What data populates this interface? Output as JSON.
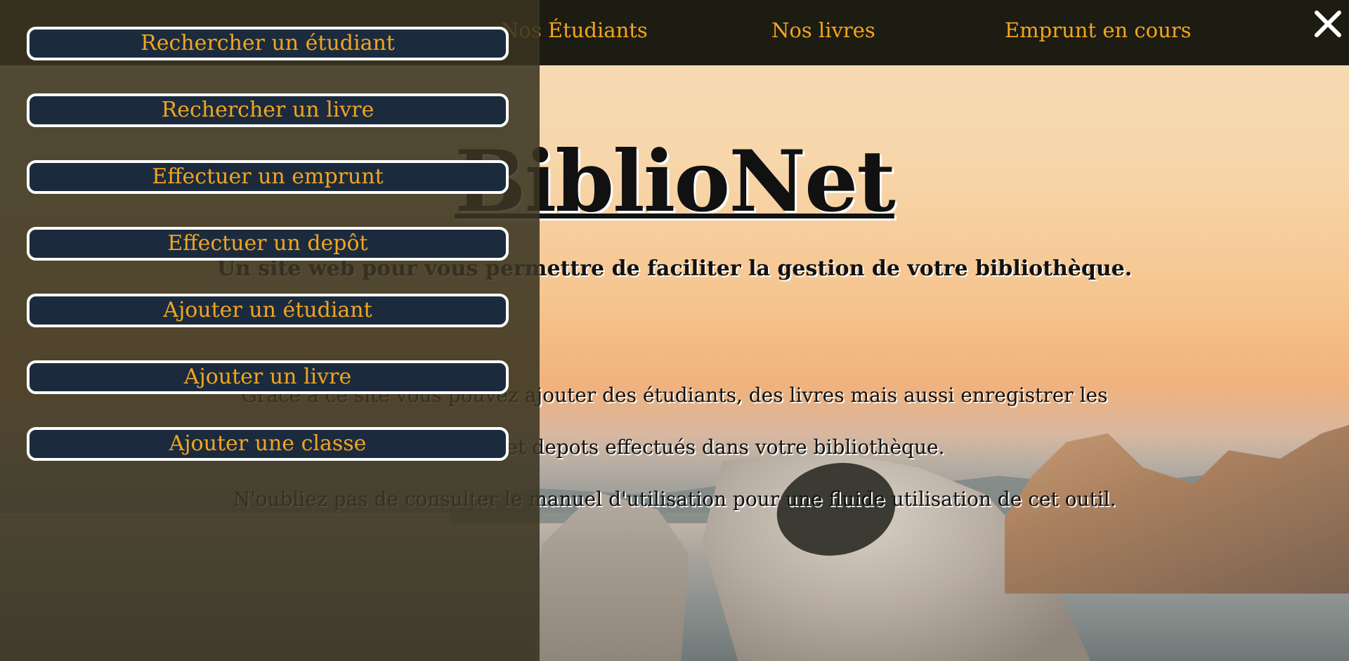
{
  "navbar": {
    "links": [
      {
        "label": "Nos Étudiants"
      },
      {
        "label": "Nos livres"
      },
      {
        "label": "Emprunt en cours"
      }
    ]
  },
  "main": {
    "title": "BiblioNet",
    "tagline": "Un site web pour vous permettre de faciliter la gestion de votre bibliothèque.",
    "paragraphs": [
      "Grâce à ce site vous pouvez ajouter des étudiants, des livres mais aussi enregistrer les",
      "emprunts et depots effectués dans votre bibliothèque.",
      "N'oubliez pas de consulter le manuel d'utilisation pour une fluide utilisation de cet outil."
    ]
  },
  "side_menu": {
    "items": [
      {
        "label": "Rechercher un étudiant"
      },
      {
        "label": "Rechercher un livre"
      },
      {
        "label": "Effectuer un emprunt"
      },
      {
        "label": "Effectuer un depôt"
      },
      {
        "label": "Ajouter un étudiant"
      },
      {
        "label": "Ajouter un livre"
      },
      {
        "label": "Ajouter une classe"
      }
    ],
    "close_icon": "close-icon"
  },
  "colors": {
    "navbar_bg": "#1d1c13",
    "accent": "#f2a51f",
    "menu_button_bg": "#1b2b3d",
    "menu_overlay": "#3a3421"
  }
}
